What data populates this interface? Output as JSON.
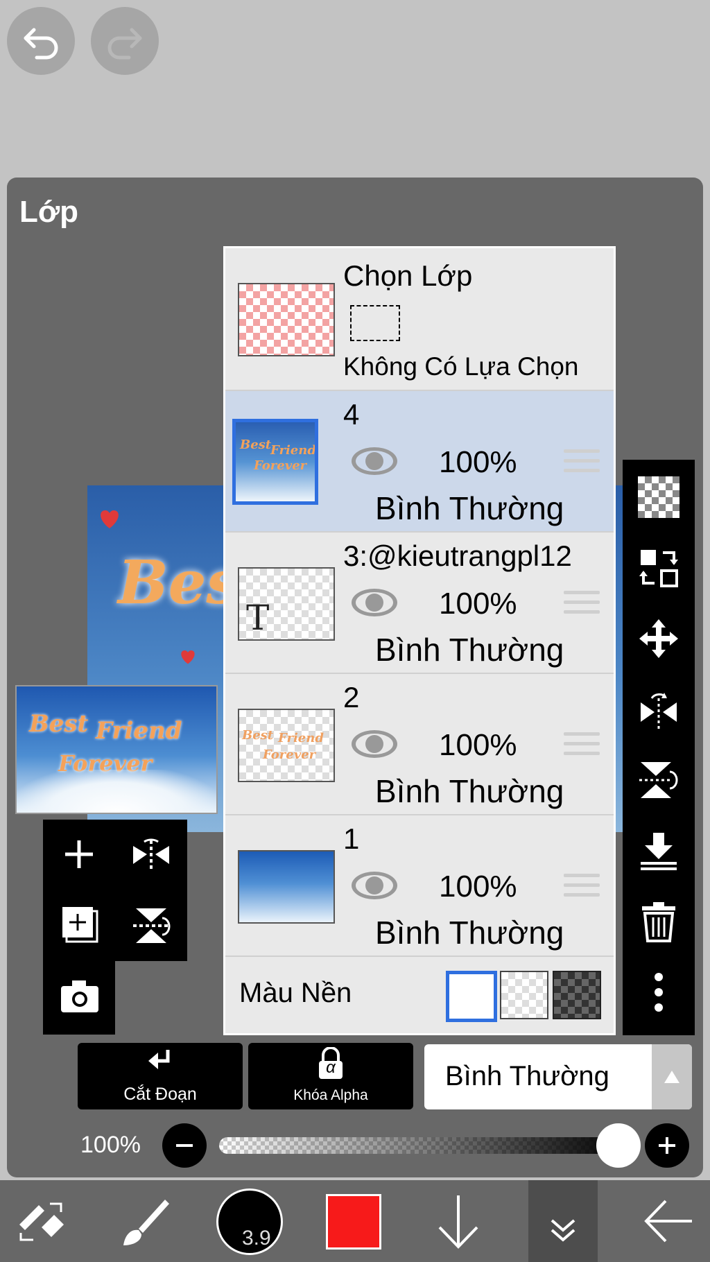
{
  "top": {
    "undo_icon": "undo-icon",
    "redo_icon": "redo-icon"
  },
  "panel": {
    "title": "Lớp"
  },
  "canvas": {
    "preview_text": "Best"
  },
  "thumbnail": {
    "line1": "Best",
    "line2": "Friend",
    "line3": "Forever"
  },
  "selection_row": {
    "title": "Chọn Lớp",
    "status": "Không Có Lựa Chọn"
  },
  "layers": [
    {
      "name": "4",
      "opacity": "100%",
      "mode": "Bình Thường",
      "selected": true
    },
    {
      "name": "3:@kieutrangpl12",
      "opacity": "100%",
      "mode": "Bình Thường",
      "selected": false,
      "thumb_glyph": "T"
    },
    {
      "name": "2",
      "opacity": "100%",
      "mode": "Bình Thường",
      "selected": false
    },
    {
      "name": "1",
      "opacity": "100%",
      "mode": "Bình Thường",
      "selected": false
    }
  ],
  "background": {
    "label": "Màu Nền",
    "options": [
      "white",
      "transparent",
      "dark"
    ],
    "selected": "white"
  },
  "actions": {
    "clip_label": "Cắt Đoạn",
    "alpha_lock_label": "Khóa Alpha",
    "alpha_glyph": "α",
    "blend_mode": "Bình Thường"
  },
  "opacity": {
    "value_label": "100%",
    "fraction": 1.0
  },
  "toolbar": {
    "brush_size": "3.9",
    "color": "#f71a1a"
  },
  "colors": {
    "accent": "#2f6fdf",
    "selected_row": "#ccd8ea",
    "panel": "#686868"
  }
}
